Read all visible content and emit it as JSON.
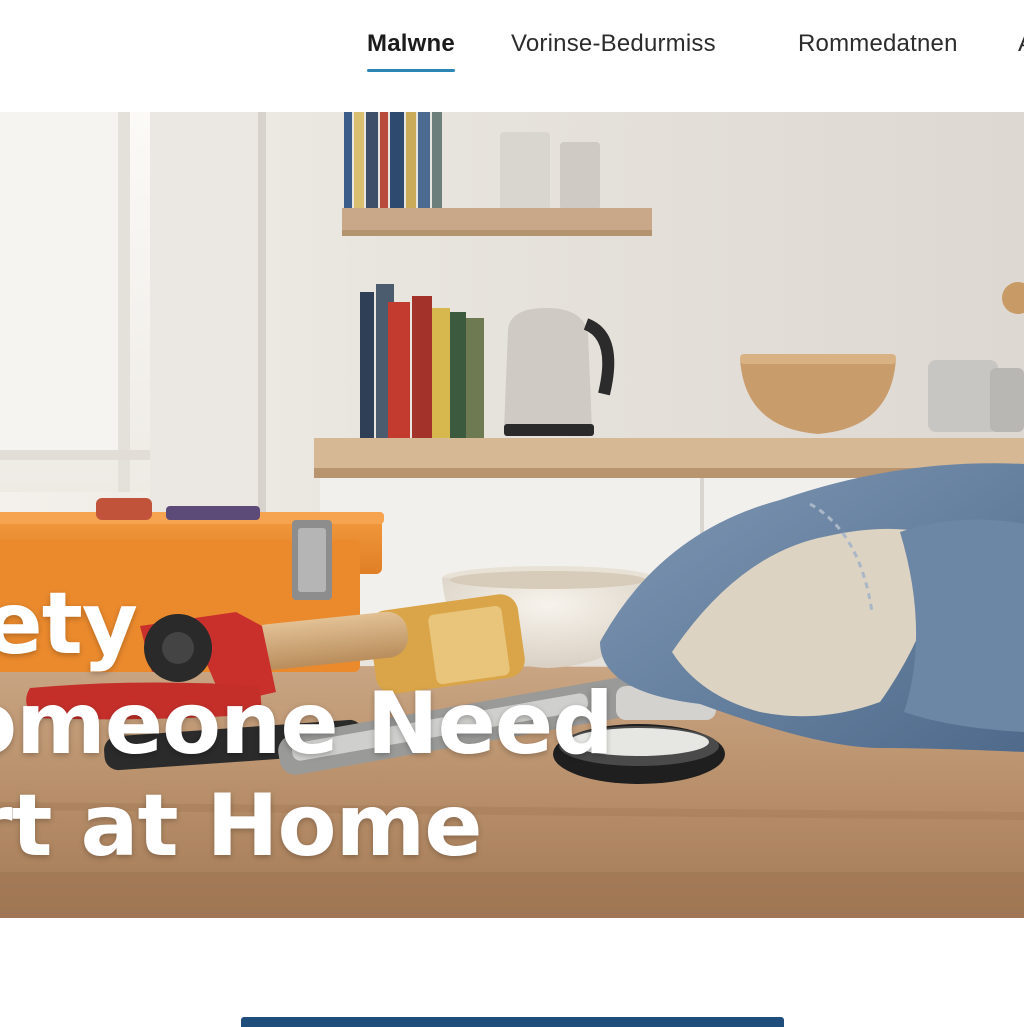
{
  "nav": {
    "items": [
      {
        "label": "Malwne",
        "active": true
      },
      {
        "label": "Vorinse-Bedurmiss",
        "active": false
      },
      {
        "label": "Rommedatnen",
        "active": false
      },
      {
        "label": "A",
        "active": false
      }
    ],
    "accent_color": "#2b86b4"
  },
  "hero": {
    "title_lines": [
      "fety",
      "omeone Need",
      "rt at Home"
    ],
    "text_color": "#ffffff"
  },
  "cta": {
    "color": "#1f4e7c"
  }
}
